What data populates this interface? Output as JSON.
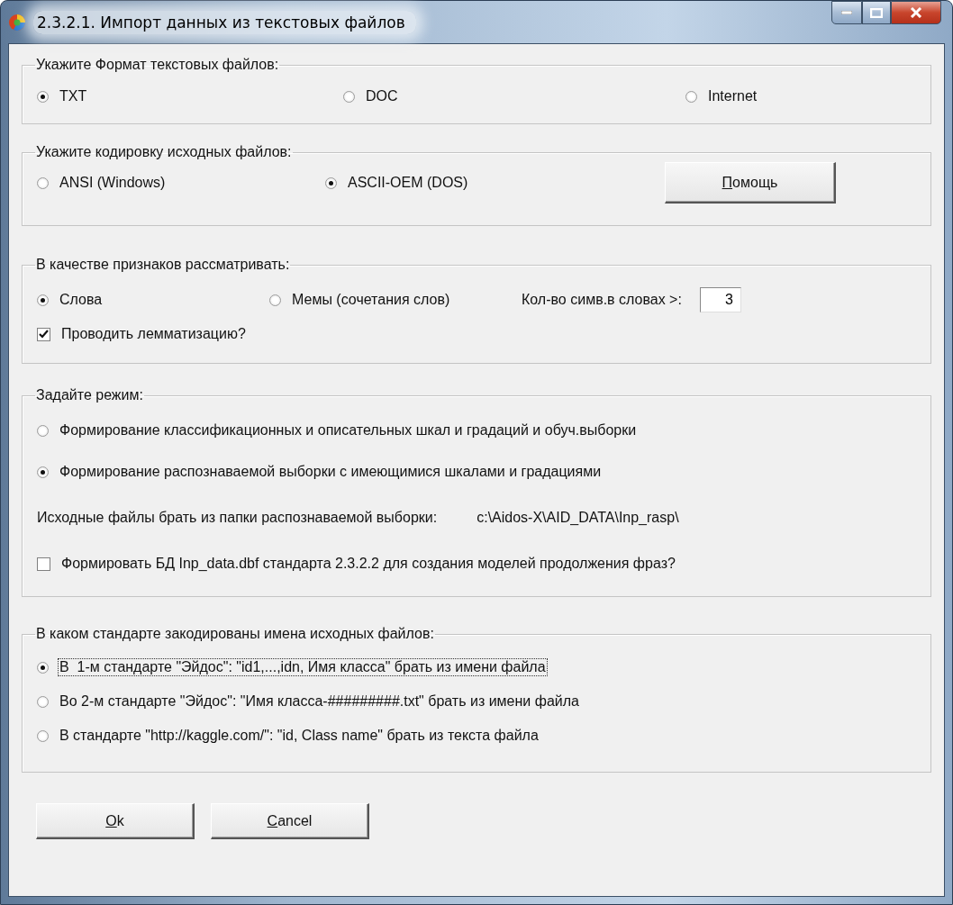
{
  "window": {
    "title": "2.3.2.1. Импорт данных из текстовых файлов"
  },
  "format": {
    "title": "Укажите Формат текстовых файлов:",
    "options": [
      {
        "label": "TXT",
        "selected": true
      },
      {
        "label": "DOC",
        "selected": false
      },
      {
        "label": "Internet",
        "selected": false
      }
    ]
  },
  "encoding": {
    "title": "Укажите кодировку исходных файлов:",
    "options": [
      {
        "label": "ANSI (Windows)",
        "selected": false
      },
      {
        "label": "ASCII-OEM (DOS)",
        "selected": true
      }
    ],
    "help_button": "Помощь"
  },
  "features": {
    "title": "В качестве признаков рассматривать:",
    "options": [
      {
        "label": "Слова",
        "selected": true
      },
      {
        "label": "Мемы (сочетания слов)",
        "selected": false
      }
    ],
    "min_chars_label": "Кол-во симв.в словах >:",
    "min_chars_value": "3",
    "lemmatize": {
      "label": "Проводить лемматизацию?",
      "checked": true
    }
  },
  "mode": {
    "title": "Задайте режим:",
    "options": [
      {
        "label": "Формирование классификационных и описательных шкал и градаций и обуч.выборки",
        "selected": false
      },
      {
        "label": "Формирование распознаваемой выборки с имеющимися шкалами и градациями",
        "selected": true
      }
    ],
    "source_label": "Исходные файлы брать из папки распознаваемой выборки:",
    "source_path": "c:\\Aidos-X\\AID_DATA\\Inp_rasp\\",
    "phrase_db": {
      "label": "Формировать БД Inp_data.dbf стандарта 2.3.2.2 для создания моделей продолжения фраз?",
      "checked": false
    }
  },
  "naming": {
    "title": "В каком стандарте закодированы имена исходных файлов:",
    "options": [
      {
        "label": "В  1-м стандарте \"Эйдос\": \"id1,...,idn, Имя класса\" брать из имени файла",
        "selected": true
      },
      {
        "label": "Во 2-м стандарте \"Эйдос\": \"Имя класса-#########.txt\" брать из имени файла",
        "selected": false
      },
      {
        "label": "В стандарте \"http://kaggle.com/\": \"id, Class name\" брать из текста файла",
        "selected": false
      }
    ]
  },
  "buttons": [
    "Ok",
    "Cancel"
  ]
}
